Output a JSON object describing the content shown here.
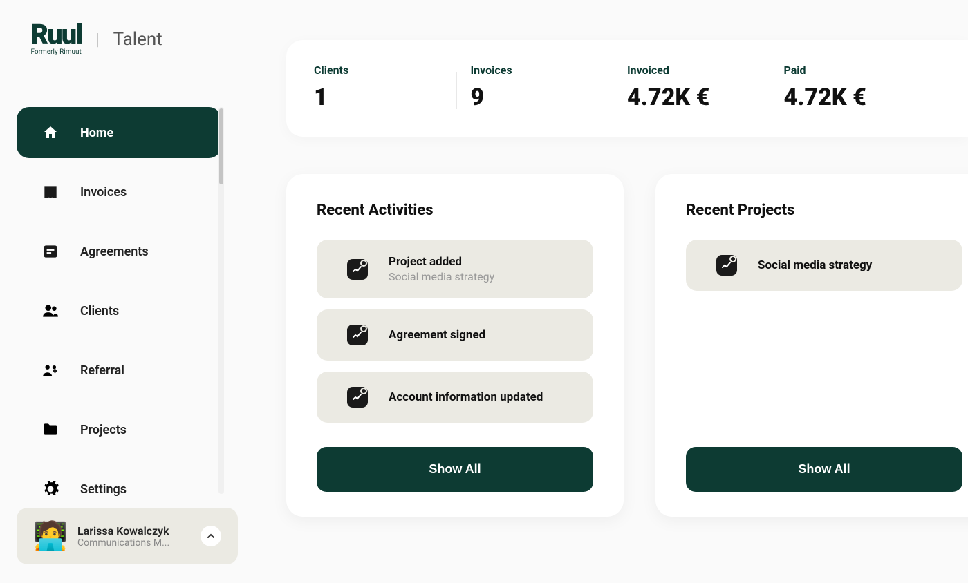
{
  "brand": {
    "name": "Ruul",
    "subtitle": "Formerly Rimuut",
    "section": "Talent"
  },
  "sidebar": {
    "items": [
      {
        "label": "Home",
        "icon": "home",
        "active": true
      },
      {
        "label": "Invoices",
        "icon": "invoice",
        "active": false
      },
      {
        "label": "Agreements",
        "icon": "agreement",
        "active": false
      },
      {
        "label": "Clients",
        "icon": "clients",
        "active": false
      },
      {
        "label": "Referral",
        "icon": "referral",
        "active": false
      },
      {
        "label": "Projects",
        "icon": "projects",
        "active": false
      },
      {
        "label": "Settings",
        "icon": "settings",
        "active": false
      }
    ]
  },
  "user": {
    "name": "Larissa Kowalczyk",
    "role": "Communications M...",
    "avatar_emoji": "🧑‍💻"
  },
  "stats": [
    {
      "label": "Clients",
      "value": "1"
    },
    {
      "label": "Invoices",
      "value": "9"
    },
    {
      "label": "Invoiced",
      "value": "4.72K €"
    },
    {
      "label": "Paid",
      "value": "4.72K €"
    }
  ],
  "activities": {
    "title": "Recent Activities",
    "items": [
      {
        "title": "Project added",
        "subtitle": "Social media strategy"
      },
      {
        "title": "Agreement signed",
        "subtitle": ""
      },
      {
        "title": "Account information updated",
        "subtitle": ""
      }
    ],
    "show_all": "Show All"
  },
  "projects": {
    "title": "Recent Projects",
    "items": [
      {
        "title": "Social media strategy"
      }
    ],
    "show_all": "Show All"
  }
}
